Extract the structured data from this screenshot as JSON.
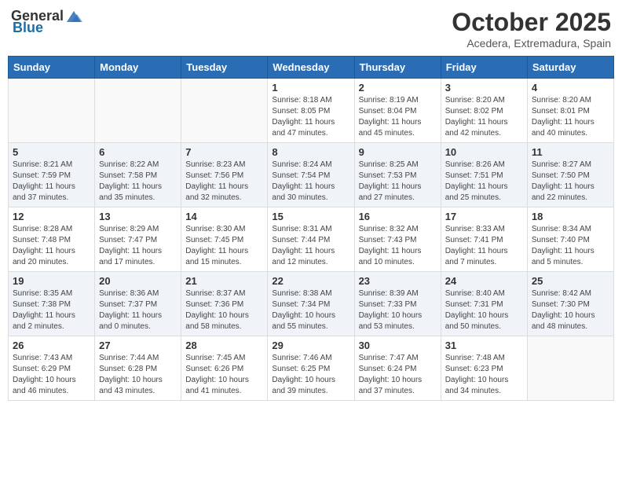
{
  "header": {
    "logo_general": "General",
    "logo_blue": "Blue",
    "month_title": "October 2025",
    "location": "Acedera, Extremadura, Spain"
  },
  "days_of_week": [
    "Sunday",
    "Monday",
    "Tuesday",
    "Wednesday",
    "Thursday",
    "Friday",
    "Saturday"
  ],
  "weeks": [
    [
      {
        "day": "",
        "info": ""
      },
      {
        "day": "",
        "info": ""
      },
      {
        "day": "",
        "info": ""
      },
      {
        "day": "1",
        "info": "Sunrise: 8:18 AM\nSunset: 8:05 PM\nDaylight: 11 hours and 47 minutes."
      },
      {
        "day": "2",
        "info": "Sunrise: 8:19 AM\nSunset: 8:04 PM\nDaylight: 11 hours and 45 minutes."
      },
      {
        "day": "3",
        "info": "Sunrise: 8:20 AM\nSunset: 8:02 PM\nDaylight: 11 hours and 42 minutes."
      },
      {
        "day": "4",
        "info": "Sunrise: 8:20 AM\nSunset: 8:01 PM\nDaylight: 11 hours and 40 minutes."
      }
    ],
    [
      {
        "day": "5",
        "info": "Sunrise: 8:21 AM\nSunset: 7:59 PM\nDaylight: 11 hours and 37 minutes."
      },
      {
        "day": "6",
        "info": "Sunrise: 8:22 AM\nSunset: 7:58 PM\nDaylight: 11 hours and 35 minutes."
      },
      {
        "day": "7",
        "info": "Sunrise: 8:23 AM\nSunset: 7:56 PM\nDaylight: 11 hours and 32 minutes."
      },
      {
        "day": "8",
        "info": "Sunrise: 8:24 AM\nSunset: 7:54 PM\nDaylight: 11 hours and 30 minutes."
      },
      {
        "day": "9",
        "info": "Sunrise: 8:25 AM\nSunset: 7:53 PM\nDaylight: 11 hours and 27 minutes."
      },
      {
        "day": "10",
        "info": "Sunrise: 8:26 AM\nSunset: 7:51 PM\nDaylight: 11 hours and 25 minutes."
      },
      {
        "day": "11",
        "info": "Sunrise: 8:27 AM\nSunset: 7:50 PM\nDaylight: 11 hours and 22 minutes."
      }
    ],
    [
      {
        "day": "12",
        "info": "Sunrise: 8:28 AM\nSunset: 7:48 PM\nDaylight: 11 hours and 20 minutes."
      },
      {
        "day": "13",
        "info": "Sunrise: 8:29 AM\nSunset: 7:47 PM\nDaylight: 11 hours and 17 minutes."
      },
      {
        "day": "14",
        "info": "Sunrise: 8:30 AM\nSunset: 7:45 PM\nDaylight: 11 hours and 15 minutes."
      },
      {
        "day": "15",
        "info": "Sunrise: 8:31 AM\nSunset: 7:44 PM\nDaylight: 11 hours and 12 minutes."
      },
      {
        "day": "16",
        "info": "Sunrise: 8:32 AM\nSunset: 7:43 PM\nDaylight: 11 hours and 10 minutes."
      },
      {
        "day": "17",
        "info": "Sunrise: 8:33 AM\nSunset: 7:41 PM\nDaylight: 11 hours and 7 minutes."
      },
      {
        "day": "18",
        "info": "Sunrise: 8:34 AM\nSunset: 7:40 PM\nDaylight: 11 hours and 5 minutes."
      }
    ],
    [
      {
        "day": "19",
        "info": "Sunrise: 8:35 AM\nSunset: 7:38 PM\nDaylight: 11 hours and 2 minutes."
      },
      {
        "day": "20",
        "info": "Sunrise: 8:36 AM\nSunset: 7:37 PM\nDaylight: 11 hours and 0 minutes."
      },
      {
        "day": "21",
        "info": "Sunrise: 8:37 AM\nSunset: 7:36 PM\nDaylight: 10 hours and 58 minutes."
      },
      {
        "day": "22",
        "info": "Sunrise: 8:38 AM\nSunset: 7:34 PM\nDaylight: 10 hours and 55 minutes."
      },
      {
        "day": "23",
        "info": "Sunrise: 8:39 AM\nSunset: 7:33 PM\nDaylight: 10 hours and 53 minutes."
      },
      {
        "day": "24",
        "info": "Sunrise: 8:40 AM\nSunset: 7:31 PM\nDaylight: 10 hours and 50 minutes."
      },
      {
        "day": "25",
        "info": "Sunrise: 8:42 AM\nSunset: 7:30 PM\nDaylight: 10 hours and 48 minutes."
      }
    ],
    [
      {
        "day": "26",
        "info": "Sunrise: 7:43 AM\nSunset: 6:29 PM\nDaylight: 10 hours and 46 minutes."
      },
      {
        "day": "27",
        "info": "Sunrise: 7:44 AM\nSunset: 6:28 PM\nDaylight: 10 hours and 43 minutes."
      },
      {
        "day": "28",
        "info": "Sunrise: 7:45 AM\nSunset: 6:26 PM\nDaylight: 10 hours and 41 minutes."
      },
      {
        "day": "29",
        "info": "Sunrise: 7:46 AM\nSunset: 6:25 PM\nDaylight: 10 hours and 39 minutes."
      },
      {
        "day": "30",
        "info": "Sunrise: 7:47 AM\nSunset: 6:24 PM\nDaylight: 10 hours and 37 minutes."
      },
      {
        "day": "31",
        "info": "Sunrise: 7:48 AM\nSunset: 6:23 PM\nDaylight: 10 hours and 34 minutes."
      },
      {
        "day": "",
        "info": ""
      }
    ]
  ]
}
